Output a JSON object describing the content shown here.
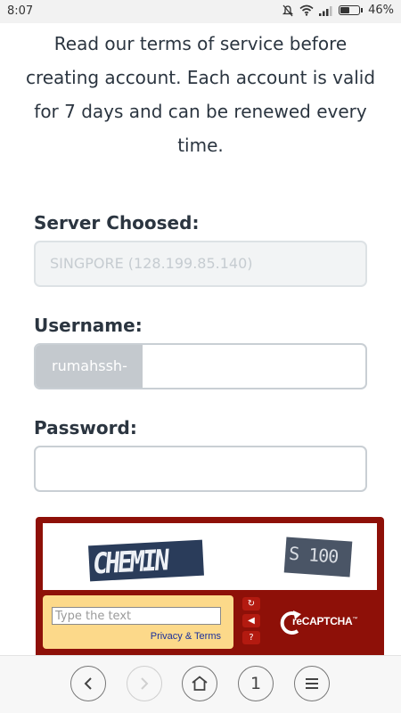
{
  "status_bar": {
    "time": "8:07",
    "battery": "46%",
    "battery_level": 0.46,
    "icons": [
      "mute-icon",
      "wifi-icon",
      "signal-icon",
      "battery-icon"
    ]
  },
  "intro_text": {
    "line1": "Read our terms of service before",
    "line2": "creating account. Each account is valid",
    "line3": "for 7 days and can be renewed every",
    "line4": "time."
  },
  "form": {
    "server_label": "Server Choosed:",
    "server_value": "SINGPORE (128.199.85.140)",
    "username_label": "Username:",
    "username_prefix": "rumahssh-",
    "username_value": "",
    "password_label": "Password:",
    "password_value": ""
  },
  "captcha": {
    "challenge_word1": "CHEMIN",
    "challenge_word2": "S 100",
    "input_placeholder": "Type the text",
    "privacy_link": "Privacy & Terms",
    "brand": "reCAPTCHA",
    "trademark": "™",
    "buttons": [
      "refresh-icon",
      "audio-icon",
      "help-icon"
    ]
  },
  "bottom_nav": {
    "tab_count": "1",
    "buttons": [
      "back",
      "forward",
      "home",
      "tabs",
      "menu"
    ]
  },
  "colors": {
    "captcha_frame": "#8e1008",
    "captcha_panel": "#fcd98a",
    "text": "#2b3540"
  }
}
